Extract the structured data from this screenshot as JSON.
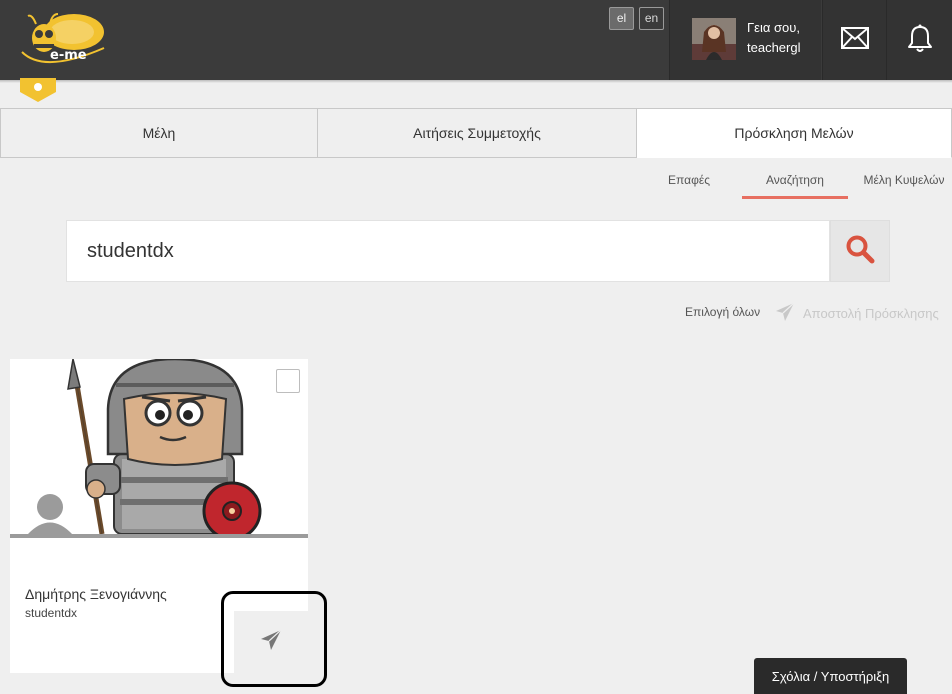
{
  "header": {
    "logo_text": "e-me",
    "languages": {
      "el": "el",
      "en": "en"
    },
    "greeting_line1": "Γεια σου,",
    "greeting_line2": "teachergl"
  },
  "icons": {
    "logo": "bee-logo-icon",
    "mail": "envelope-icon",
    "bell": "bell-icon",
    "search": "search-icon",
    "send": "paper-plane-icon",
    "badge": "hexagon-badge-icon"
  },
  "tabs": [
    {
      "label": "Μέλη"
    },
    {
      "label": "Αιτήσεις Συμμετοχής"
    },
    {
      "label": "Πρόσκληση Μελών"
    }
  ],
  "subtabs": [
    {
      "label": "Επαφές"
    },
    {
      "label": "Αναζήτηση"
    },
    {
      "label": "Μέλη Κυψελών"
    }
  ],
  "search": {
    "value": "studentdx"
  },
  "actions": {
    "select_all": "Επιλογή όλων",
    "send_invite": "Αποστολή Πρόσκλησης"
  },
  "card": {
    "name": "Δημήτρης Ξενογιάννης",
    "username": "studentdx"
  },
  "feedback": {
    "label": "Σχόλια / Υποστήριξη"
  },
  "colors": {
    "header_bg": "#3b3b3b",
    "accent": "#e76f61",
    "logo_yellow": "#f2c230",
    "search_icon": "#d9533f"
  }
}
